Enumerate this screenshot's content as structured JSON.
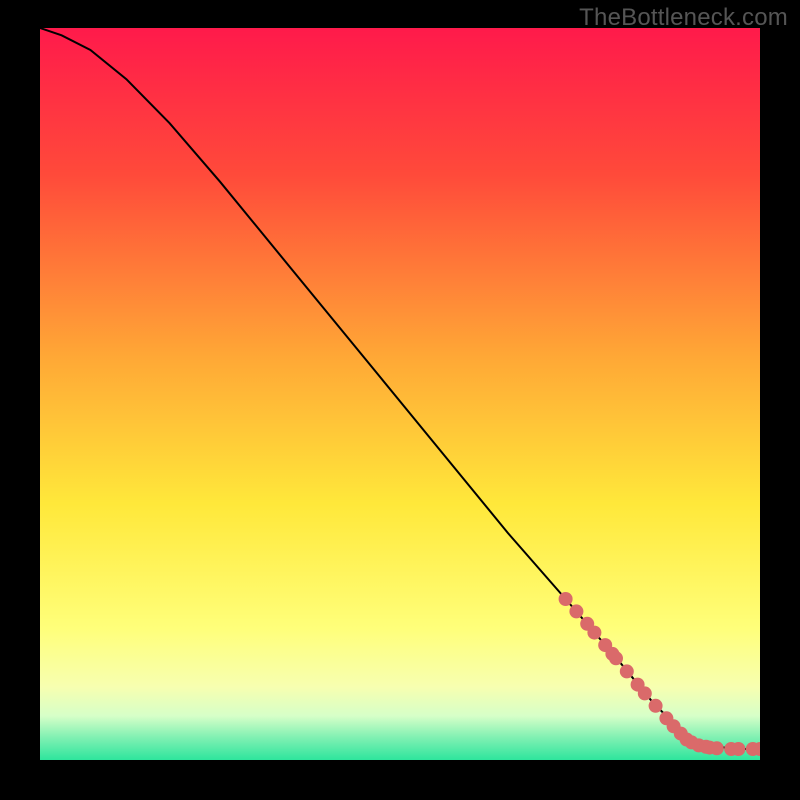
{
  "watermark": "TheBottleneck.com",
  "chart_data": {
    "type": "line",
    "title": "",
    "xlabel": "",
    "ylabel": "",
    "xlim": [
      0,
      100
    ],
    "ylim": [
      0,
      100
    ],
    "background_gradient": {
      "stops": [
        {
          "offset": 0.0,
          "color": "#ff1a4b"
        },
        {
          "offset": 0.2,
          "color": "#ff4a3a"
        },
        {
          "offset": 0.45,
          "color": "#ffa836"
        },
        {
          "offset": 0.65,
          "color": "#ffe83a"
        },
        {
          "offset": 0.82,
          "color": "#ffff7a"
        },
        {
          "offset": 0.9,
          "color": "#f7ffb0"
        },
        {
          "offset": 0.94,
          "color": "#d6ffc8"
        },
        {
          "offset": 0.97,
          "color": "#7ef0b2"
        },
        {
          "offset": 1.0,
          "color": "#2ee59d"
        }
      ]
    },
    "series": [
      {
        "name": "curve",
        "color": "#000000",
        "x": [
          0,
          3,
          7,
          12,
          18,
          25,
          35,
          45,
          55,
          65,
          73,
          80,
          85,
          88,
          90,
          92,
          94,
          96,
          98,
          100
        ],
        "y": [
          100,
          99,
          97,
          93,
          87,
          79,
          67,
          55,
          43,
          31,
          22,
          14,
          8,
          5,
          3,
          2.2,
          1.8,
          1.6,
          1.5,
          1.5
        ]
      }
    ],
    "scatter": {
      "name": "highlighted-points",
      "color": "#da6a6a",
      "radius_px": 7,
      "points": [
        {
          "x": 73,
          "y": 22
        },
        {
          "x": 74.5,
          "y": 20.3
        },
        {
          "x": 76,
          "y": 18.6
        },
        {
          "x": 77,
          "y": 17.4
        },
        {
          "x": 78.5,
          "y": 15.7
        },
        {
          "x": 79.5,
          "y": 14.5
        },
        {
          "x": 80,
          "y": 13.9
        },
        {
          "x": 81.5,
          "y": 12.1
        },
        {
          "x": 83,
          "y": 10.3
        },
        {
          "x": 84,
          "y": 9.1
        },
        {
          "x": 85.5,
          "y": 7.4
        },
        {
          "x": 87,
          "y": 5.7
        },
        {
          "x": 88,
          "y": 4.6
        },
        {
          "x": 89,
          "y": 3.6
        },
        {
          "x": 89.8,
          "y": 2.8
        },
        {
          "x": 90.5,
          "y": 2.4
        },
        {
          "x": 91.5,
          "y": 2.0
        },
        {
          "x": 92.5,
          "y": 1.8
        },
        {
          "x": 93,
          "y": 1.7
        },
        {
          "x": 94,
          "y": 1.6
        },
        {
          "x": 96,
          "y": 1.5
        },
        {
          "x": 97,
          "y": 1.5
        },
        {
          "x": 99,
          "y": 1.5
        },
        {
          "x": 100,
          "y": 1.5
        }
      ]
    }
  }
}
